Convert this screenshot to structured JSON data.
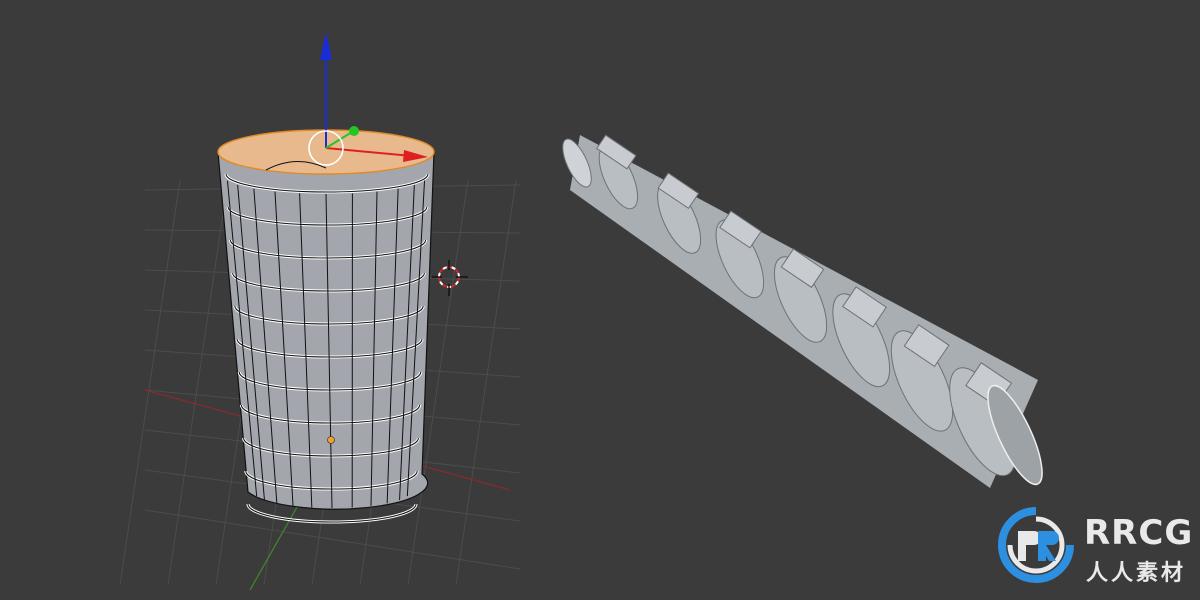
{
  "viewport": {
    "background": "#3b3b3b",
    "grid_color": "#4c4c4c",
    "x_axis_color": "#8a2a2a",
    "y_axis_color": "#3f8a2a"
  },
  "gizmo": {
    "x_axis_color": "#e02020",
    "y_axis_color": "#22c822",
    "z_axis_color": "#1a2cd8",
    "icon": "transform-gizmo-icon"
  },
  "cursor": {
    "icon": "3d-cursor-icon",
    "color": "#e02020"
  },
  "models": {
    "left": {
      "name": "cylinder-edit-mode",
      "face_color": "#a3a7ad",
      "selected_face_color": "#e8b98c",
      "edge_color": "#111111",
      "rows": 10,
      "columns": 12
    },
    "right": {
      "name": "cylinder-shaded",
      "color": "#b9bec3"
    }
  },
  "watermark": {
    "title": "RRCG",
    "subtitle": "人人素材",
    "color": "#2c8fe0"
  }
}
